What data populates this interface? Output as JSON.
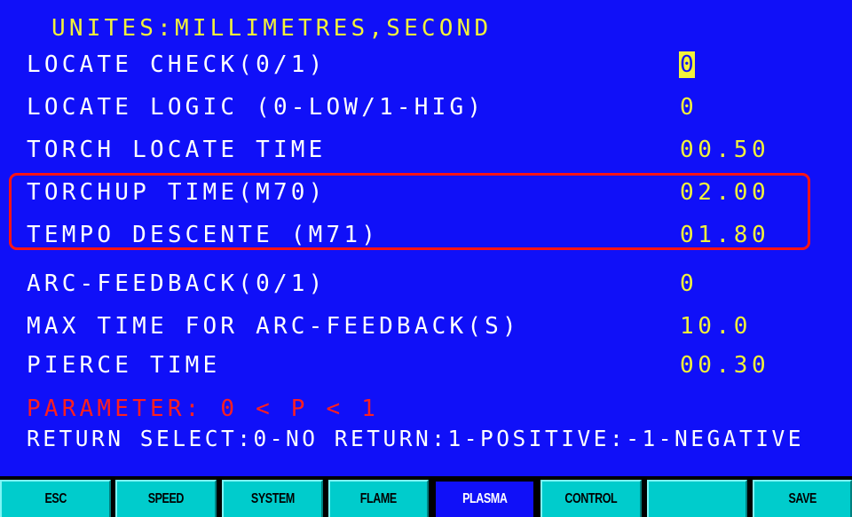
{
  "header": {
    "units": "UNITES:MILLIMETRES,SECOND"
  },
  "params": [
    {
      "label": "LOCATE CHECK(0/1)",
      "value": "0"
    },
    {
      "label": "LOCATE LOGIC (0-LOW/1-HIG)",
      "value": "0"
    },
    {
      "label": "TORCH LOCATE TIME",
      "value": "00.50"
    },
    {
      "label": "TORCHUP TIME(M70)",
      "value": "02.00"
    },
    {
      "label": "TEMPO DESCENTE (M71)",
      "value": "01.80"
    },
    {
      "label": "ARC-FEEDBACK(0/1)",
      "value": "0"
    },
    {
      "label": "MAX TIME FOR ARC-FEEDBACK(S)",
      "value": "10.0"
    },
    {
      "label": "PIERCE TIME",
      "value": "00.30"
    }
  ],
  "hint": {
    "range": "PARAMETER: 0  < P < 1",
    "info": "RETURN SELECT:0-NO RETURN:1-POSITIVE:-1-NEGATIVE"
  },
  "softkeys": [
    {
      "label": "ESC"
    },
    {
      "label": "SPEED"
    },
    {
      "label": "SYSTEM"
    },
    {
      "label": "FLAME"
    },
    {
      "label": "PLASMA"
    },
    {
      "label": "CONTROL"
    },
    {
      "label": ""
    },
    {
      "label": "SAVE"
    }
  ],
  "colors": {
    "background": "#1010f8",
    "value_text": "#f2f23a",
    "label_text": "#ffffff",
    "hint_text": "#ff1f1f",
    "highlight_border": "#ff1414",
    "softkey_bg": "#00cccc"
  },
  "selected_softkey": "PLASMA",
  "active_param": "LOCATE CHECK(0/1)"
}
